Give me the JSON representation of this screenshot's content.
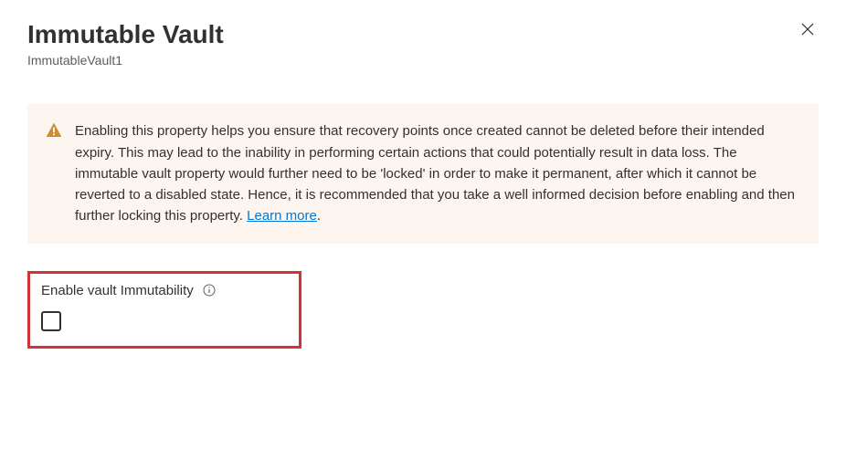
{
  "header": {
    "title": "Immutable Vault",
    "subtitle": "ImmutableVault1"
  },
  "warning": {
    "text": "Enabling this property helps you ensure that recovery points once created cannot be deleted before their intended expiry. This may lead to the inability in performing certain actions that could potentially result in data loss. The immutable vault property would further need to be 'locked' in order to make it permanent, after which it cannot be reverted to a disabled state. Hence, it is recommended that you take a well informed decision before enabling and then further locking this property. ",
    "link_text": "Learn more"
  },
  "control": {
    "label": "Enable vault Immutability",
    "checked": false
  }
}
